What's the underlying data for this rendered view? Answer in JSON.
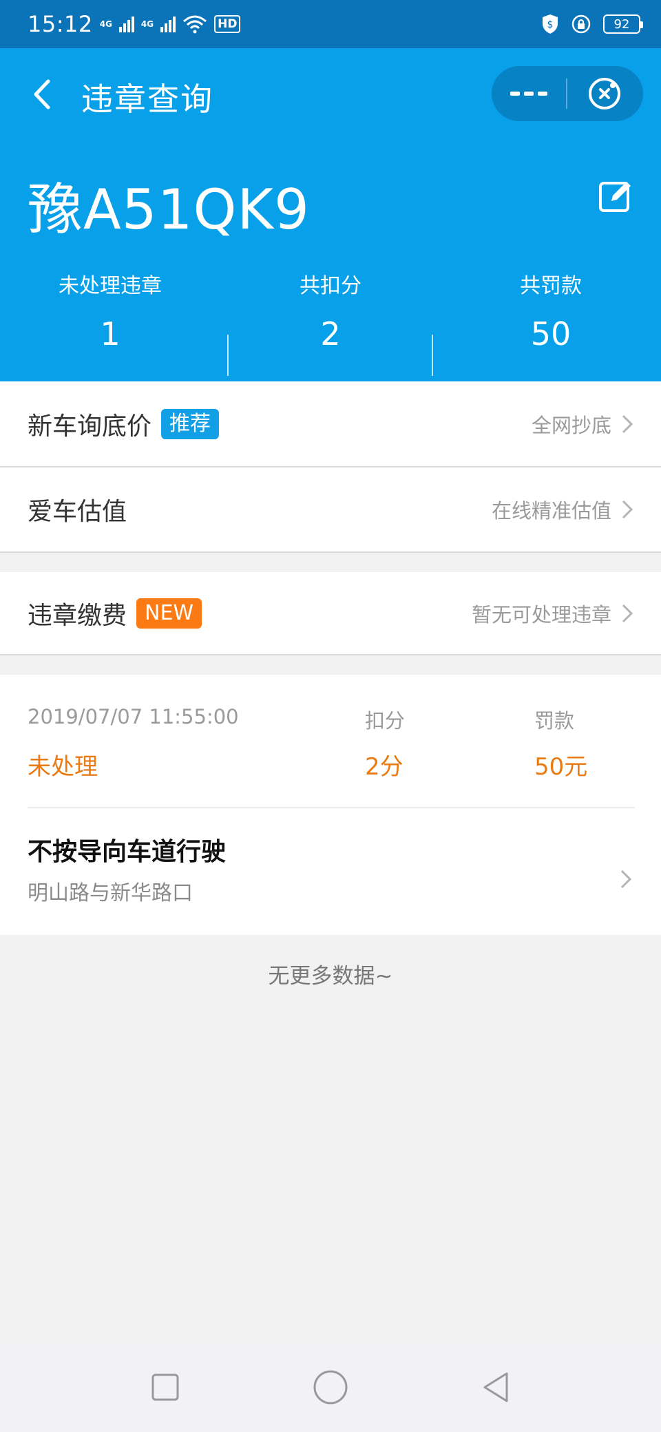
{
  "status_bar": {
    "time": "15:12",
    "network_1": "4G",
    "network_2": "4G",
    "hd_label": "HD",
    "battery": "92",
    "icons": [
      "signal-icon",
      "wifi-icon",
      "hd-icon",
      "shield-icon",
      "lock-icon",
      "battery-icon"
    ]
  },
  "nav": {
    "title": "违章查询",
    "back_icon": "chevron-left-icon",
    "more_icon": "more-icon",
    "close_icon": "close-circle-icon"
  },
  "vehicle": {
    "plate": "豫A51QK9",
    "edit_icon": "edit-icon"
  },
  "stats": [
    {
      "label": "未处理违章",
      "value": "1"
    },
    {
      "label": "共扣分",
      "value": "2"
    },
    {
      "label": "共罚款",
      "value": "50"
    }
  ],
  "menu": {
    "new_car": {
      "title": "新车询底价",
      "tag": "推荐",
      "sub": "全网抄底"
    },
    "valuation": {
      "title": "爱车估值",
      "sub": "在线精准估值"
    },
    "payment": {
      "title": "违章缴费",
      "tag": "NEW",
      "sub": "暂无可处理违章"
    }
  },
  "record": {
    "datetime": "2019/07/07 11:55:00",
    "points_label": "扣分",
    "fine_label": "罚款",
    "status": "未处理",
    "points": "2分",
    "fine": "50元",
    "violation": "不按导向车道行驶",
    "location": "明山路与新华路口"
  },
  "footer": {
    "no_more": "无更多数据~"
  },
  "colors": {
    "header_blue": "#08a0e9",
    "status_bar": "#0b74b8",
    "tag_blue": "#11a0e6",
    "tag_orange": "#fb7a14",
    "warning_orange": "#ea7a12"
  },
  "system_nav": [
    "square-icon",
    "circle-icon",
    "triangle-back-icon"
  ]
}
